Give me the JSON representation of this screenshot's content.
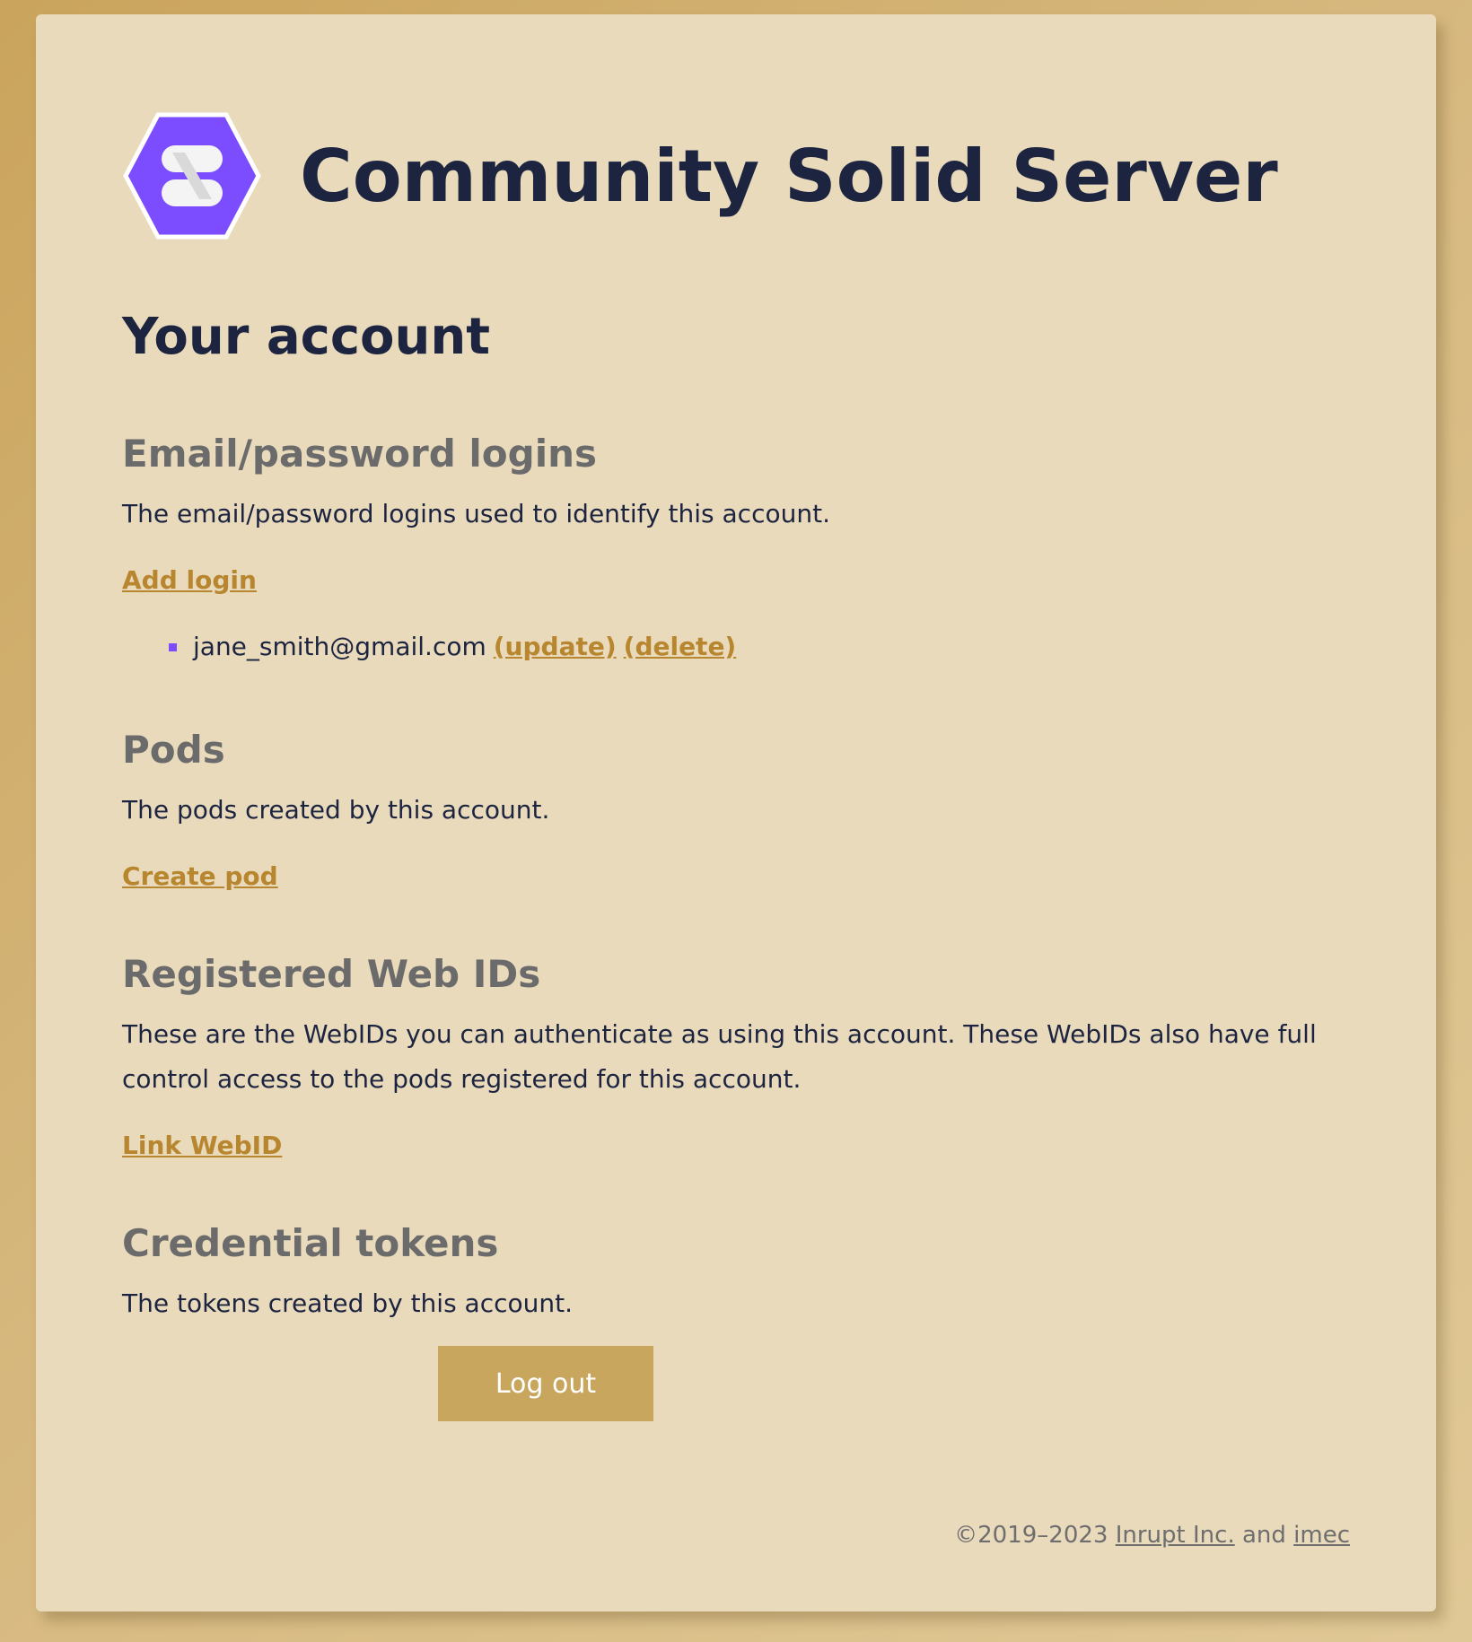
{
  "header": {
    "title": "Community Solid Server",
    "logo_icon": "solid-hexagon-logo",
    "logo_color": "#7c4dff"
  },
  "page": {
    "title": "Your account"
  },
  "logins": {
    "heading": "Email/password logins",
    "description": "The email/password logins used to identify this account.",
    "add_label": "Add login",
    "items": [
      {
        "email": "jane_smith@gmail.com",
        "update_label": "(update)",
        "delete_label": "(delete)"
      }
    ]
  },
  "pods": {
    "heading": "Pods",
    "description": "The pods created by this account.",
    "create_label": "Create pod"
  },
  "webids": {
    "heading": "Registered Web IDs",
    "description": "These are the WebIDs you can authenticate as using this account. These WebIDs also have full control access to the pods registered for this account.",
    "link_label": "Link WebID"
  },
  "tokens": {
    "heading": "Credential tokens",
    "description": "The tokens created by this account."
  },
  "logout": {
    "label": "Log out"
  },
  "footer": {
    "copyright": "©2019–2023 ",
    "org1": "Inrupt Inc.",
    "and": " and ",
    "org2": "imec"
  },
  "colors": {
    "accent_link": "#b8862e",
    "button_bg": "#c9a65e",
    "card_bg": "#e9dabb",
    "title_text": "#1c2440"
  }
}
